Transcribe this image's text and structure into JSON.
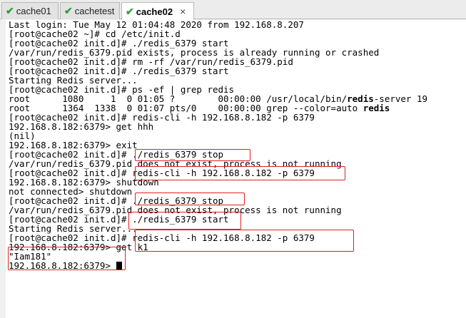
{
  "tabs": [
    {
      "label": "cache01",
      "active": false
    },
    {
      "label": "cachetest",
      "active": false
    },
    {
      "label": "cache02",
      "active": true
    }
  ],
  "tab_close_glyph": "×",
  "terminal": {
    "lines": [
      "Last login: Tue May 12 01:04:48 2020 from 192.168.8.207",
      "[root@cache02 ~]# cd /etc/init.d",
      "[root@cache02 init.d]# ./redis_6379 start",
      "/var/run/redis_6379.pid exists, process is already running or crashed",
      "[root@cache02 init.d]# rm -rf /var/run/redis_6379.pid",
      "[root@cache02 init.d]# ./redis_6379 start",
      "Starting Redis server...",
      "[root@cache02 init.d]# ps -ef | grep redis",
      {
        "pre": "root      1080     1  0 01:05 ?        00:00:00 /usr/local/bin/",
        "bold": "redis",
        "post": "-server 19"
      },
      {
        "pre": "root      1364  1338  0 01:07 pts/0    00:00:00 grep --color=auto ",
        "bold": "redis",
        "post": ""
      },
      "[root@cache02 init.d]# redis-cli -h 192.168.8.182 -p 6379",
      "192.168.8.182:6379> get hhh",
      "(nil)",
      "192.168.8.182:6379> exit",
      "[root@cache02 init.d]# ./redis_6379 stop",
      "/var/run/redis_6379.pid does not exist, process is not running",
      "[root@cache02 init.d]# redis-cli -h 192.168.8.182 -p 6379",
      "192.168.8.182:6379> shutdown",
      "not connected> shutdown",
      "[root@cache02 init.d]# ./redis_6379 stop",
      "/var/run/redis_6379.pid does not exist, process is not running",
      "[root@cache02 init.d]# ./redis_6379 start",
      "Starting Redis server...",
      "[root@cache02 init.d]# redis-cli -h 192.168.8.182 -p 6379",
      "192.168.8.182:6379> get k1",
      "\"Iam181\"",
      "192.168.8.182:6379> "
    ]
  },
  "annotation_color": "#e02020"
}
